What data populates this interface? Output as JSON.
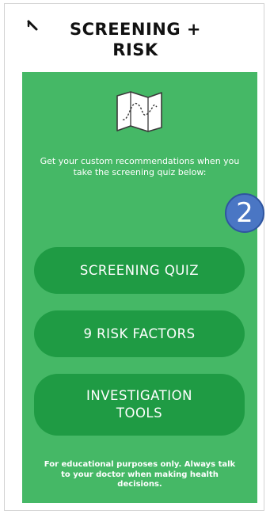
{
  "header": {
    "title": "SCREENING + RISK",
    "back_icon": "back-arrow-icon"
  },
  "panel": {
    "icon": "folded-map-icon",
    "intro": "Get your custom recommendations when you take the screening quiz below:",
    "buttons": [
      {
        "label": "SCREENING QUIZ"
      },
      {
        "label": "9 RISK FACTORS"
      },
      {
        "label": "INVESTIGATION TOOLS"
      }
    ],
    "disclaimer": "For educational purposes only. Always talk to your doctor when making health decisions."
  },
  "annotation": {
    "step_number": "2"
  },
  "colors": {
    "panel_bg": "#45b866",
    "button_bg": "#1f9b44",
    "badge_bg": "#4a76c4",
    "text_light": "#ffffff",
    "title_text": "#111111"
  }
}
